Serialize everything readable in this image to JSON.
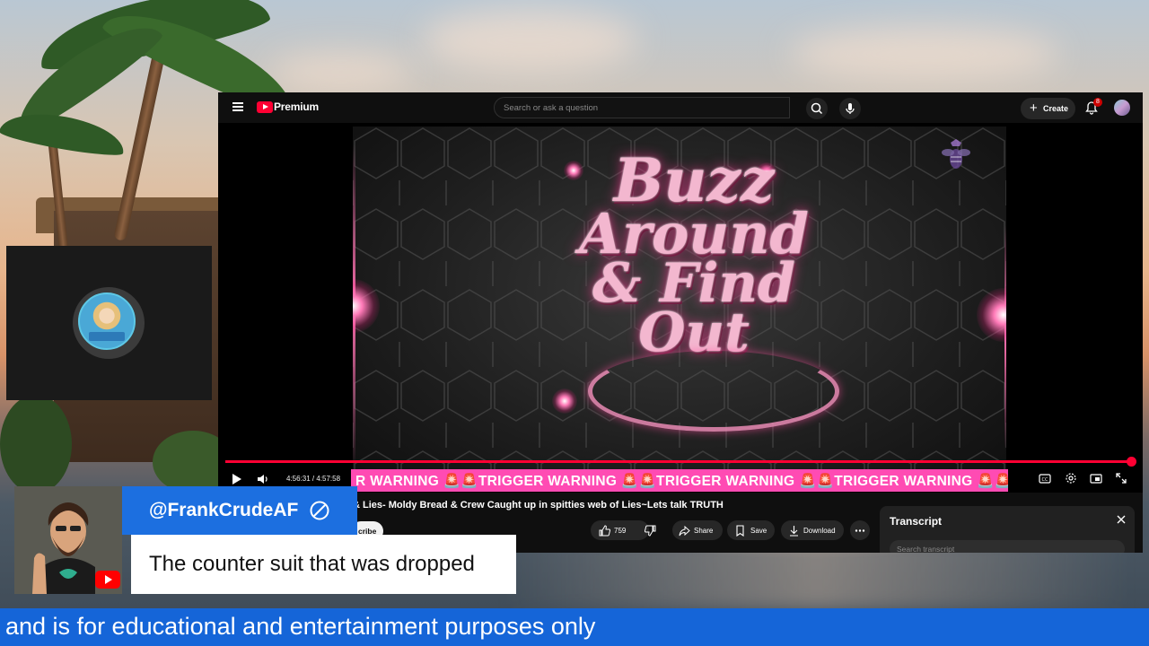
{
  "youtube": {
    "logo_label": "Premium",
    "search_placeholder": "Search or ask a question",
    "create_label": "Create",
    "notifications_count": "8",
    "video": {
      "title": "& Lies- Moldy Bread & Crew Caught up in spitties web of Lies~Lets talk TRUTH",
      "time_display": "4:56:31 / 4:57:58",
      "progress_fraction": 0.995,
      "thumbnail_text": [
        "Buzz",
        "Around",
        "& Find Out"
      ],
      "ticker_text": "R WARNING 🚨🚨TRIGGER WARNING 🚨🚨TRIGGER WARNING 🚨🚨TRIGGER WARNING 🚨🚨TRIGGER WARNING 🚨🚨Tr"
    },
    "actions": {
      "subscribe_label": "cribe",
      "likes": "759",
      "share_label": "Share",
      "save_label": "Save",
      "download_label": "Download"
    },
    "transcript": {
      "title": "Transcript",
      "search_placeholder": "Search transcript"
    }
  },
  "chat": {
    "username": "@FrankCrudeAF",
    "message": "The counter suit that was dropped"
  },
  "bottom_ticker": {
    "text": "and is for educational and entertainment purposes only"
  },
  "colors": {
    "youtube_red": "#ff0033",
    "ticker_pink": "#ff4bb3",
    "chat_blue": "#1c6fe0",
    "bottom_bar_blue": "#1565d8"
  }
}
